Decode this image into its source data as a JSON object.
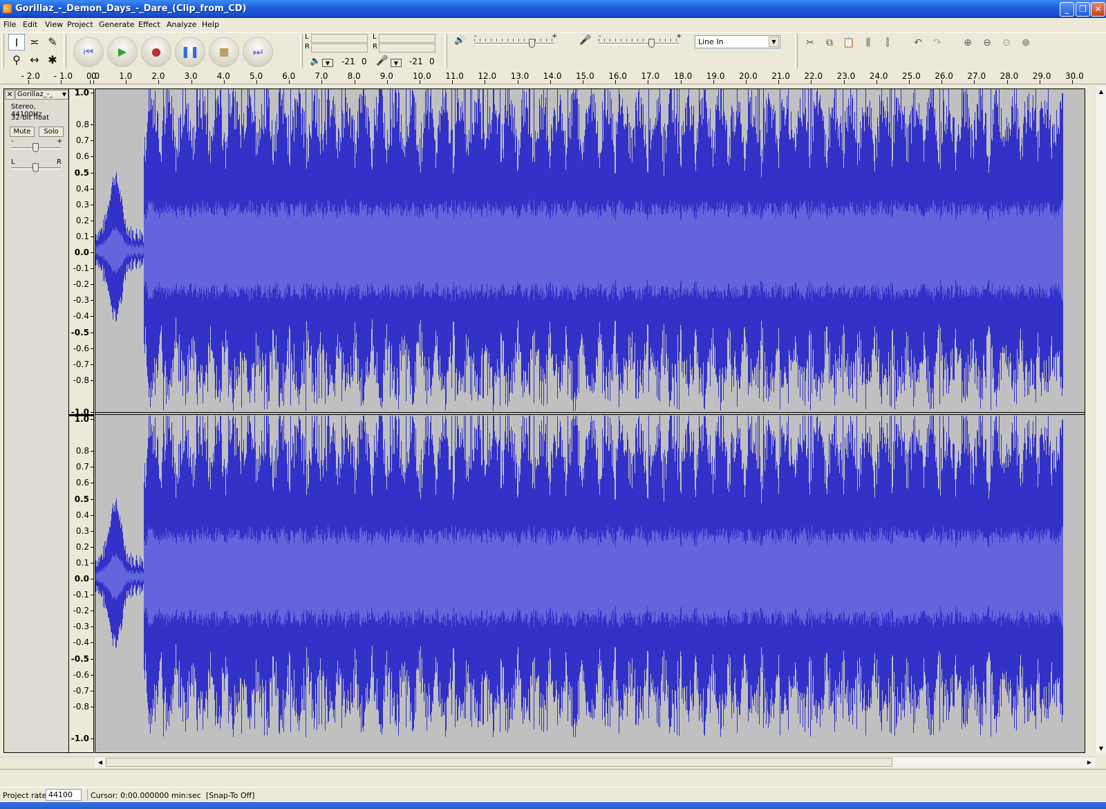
{
  "window": {
    "title": "Gorillaz_-_Demon_Days_-_Dare_(Clip_from_CD)"
  },
  "menu": [
    "File",
    "Edit",
    "View",
    "Project",
    "Generate",
    "Effect",
    "Analyze",
    "Help"
  ],
  "meters": {
    "output": {
      "left": "L",
      "right": "R",
      "db_left": "-21",
      "db_right": "0"
    },
    "input": {
      "left": "L",
      "right": "R",
      "db_left": "-21",
      "db_right": "0"
    }
  },
  "mixer": {
    "output_minus": "-",
    "output_plus": "+",
    "input_minus": "-",
    "input_plus": "+",
    "input_source": "Line In",
    "output_volume": 0.72,
    "input_volume": 0.66
  },
  "ruler": {
    "labels": [
      "- 2.0",
      "- 1.0",
      "0",
      "0.0",
      "1.0",
      "2.0",
      "3.0",
      "4.0",
      "5.0",
      "6.0",
      "7.0",
      "8.0",
      "9.0",
      "10.0",
      "11.0",
      "12.0",
      "13.0",
      "14.0",
      "15.0",
      "16.0",
      "17.0",
      "18.0",
      "19.0",
      "20.0",
      "21.0",
      "22.0",
      "23.0",
      "24.0",
      "25.0",
      "26.0",
      "27.0",
      "28.0",
      "29.0",
      "30.0"
    ]
  },
  "track": {
    "name": "Gorillaz_-_",
    "format": "Stereo, 44100Hz",
    "bitdepth": "32-bit float",
    "mute_label": "Mute",
    "solo_label": "Solo",
    "gain_minus": "-",
    "gain_plus": "+",
    "pan_left": "L",
    "pan_right": "R",
    "gain_value": 0.5,
    "pan_value": 0.5
  },
  "amplitude_scale": [
    "1.0",
    "0.8",
    "0.7",
    "0.6",
    "0.5",
    "0.4",
    "0.3",
    "0.2",
    "0.1",
    "0.0",
    "-0.1",
    "-0.2",
    "-0.3",
    "-0.4",
    "-0.5",
    "-0.6",
    "-0.7",
    "-0.8",
    "-1.0"
  ],
  "status": {
    "project_rate_label": "Project rate:",
    "project_rate": "44100",
    "cursor": "Cursor: 0:00.000000 min:sec",
    "snap": "[Snap-To Off]"
  },
  "colors": {
    "waveform_peak": "#3232c8",
    "waveform_rms": "#6464dc",
    "track_background": "#c0c0c0"
  }
}
